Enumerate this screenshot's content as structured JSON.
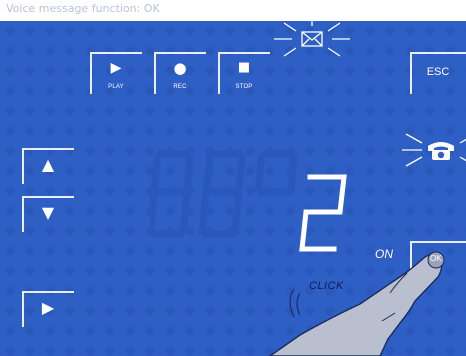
{
  "header": {
    "text": "Voice message function: OK"
  },
  "transport": {
    "play_label": "PLAY",
    "rec_label": "REC",
    "stop_label": "STOP"
  },
  "esc_label": "ESC",
  "display_digit": "2",
  "on_label": "ON",
  "ok_label": "OK",
  "click_label": "CLICK",
  "icons": {
    "envelope": "envelope-icon",
    "telephone": "telephone-icon",
    "play": "play-icon",
    "rec": "record-icon",
    "stop": "stop-icon",
    "up": "arrow-up-icon",
    "down": "arrow-down-icon",
    "right": "arrow-right-icon"
  },
  "colors": {
    "panel": "#2e5fc4",
    "panel_dark": "#2753b3",
    "white": "#ffffff",
    "hand": "#b9bfcf"
  }
}
